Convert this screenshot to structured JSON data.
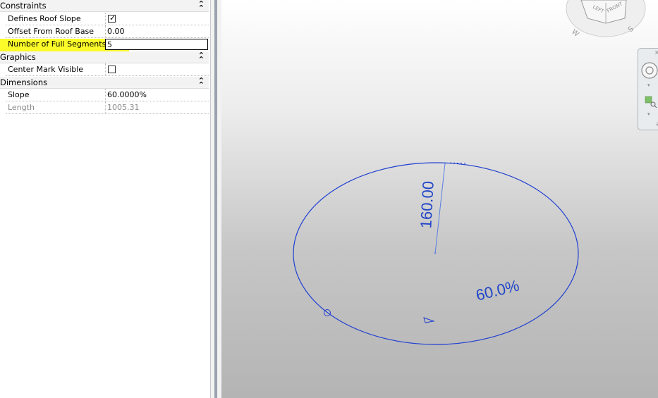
{
  "properties": {
    "groups": {
      "constraints": {
        "title": "Constraints",
        "toggle": "⌃⌃"
      },
      "graphics": {
        "title": "Graphics",
        "toggle": "⌃⌃"
      },
      "dimensions": {
        "title": "Dimensions",
        "toggle": "⌃⌃"
      }
    },
    "rows": {
      "defines_roof_slope": {
        "label": "Defines Roof Slope",
        "checked": true
      },
      "offset_from_roof_base": {
        "label": "Offset From Roof Base",
        "value": "0.00"
      },
      "number_of_full_segments": {
        "label": "Number of Full Segments",
        "value": "5"
      },
      "center_mark_visible": {
        "label": "Center Mark Visible",
        "checked": false
      },
      "slope": {
        "label": "Slope",
        "value": "60.0000%"
      },
      "length": {
        "label": "Length",
        "value": "1005.31"
      }
    },
    "highlight_color": "#fbfb2a"
  },
  "canvas": {
    "radius_dimension": "160.00",
    "slope_annotation": "60.0%",
    "sketch_color": "#1f3fd1",
    "viewcube": {
      "face_front": "FRONT",
      "face_left": "LEFT",
      "compass_w": "W",
      "compass_s": "S"
    }
  }
}
